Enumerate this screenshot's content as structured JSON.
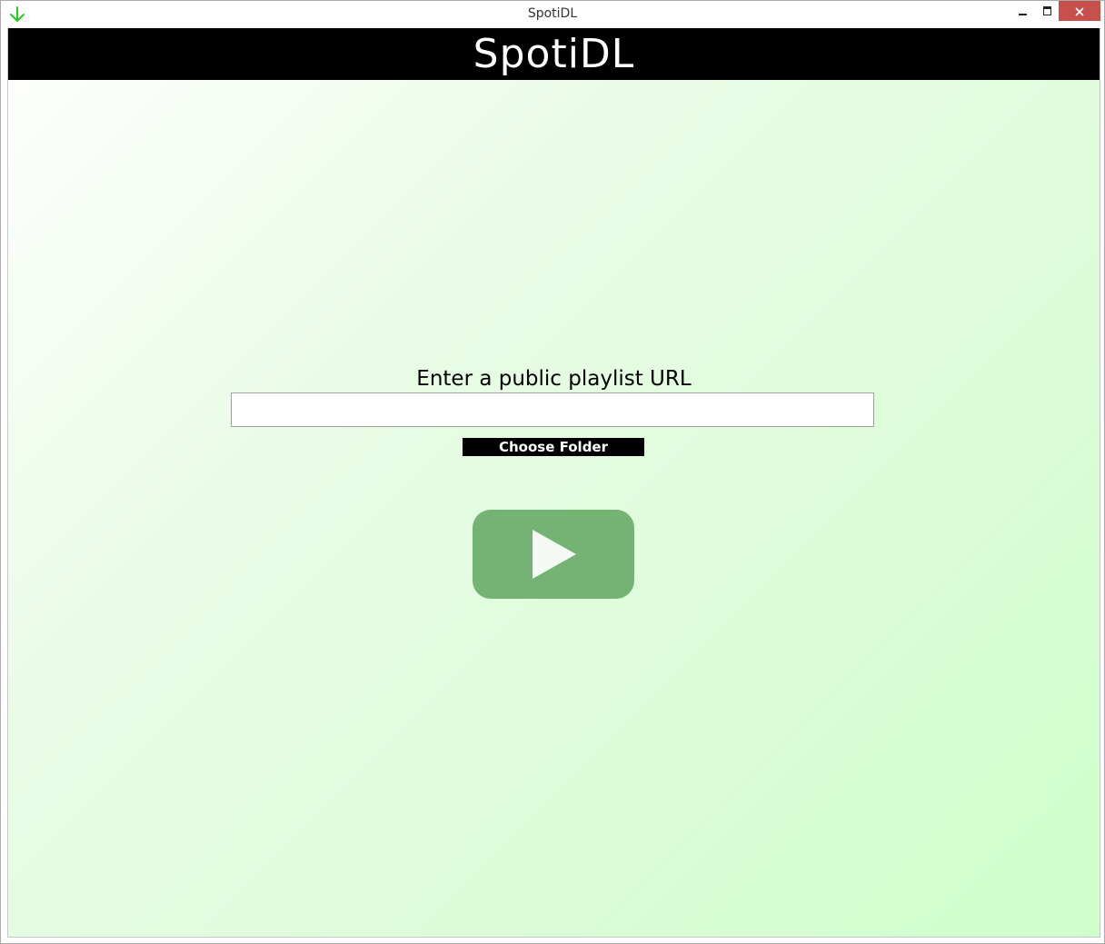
{
  "window": {
    "title": "SpotiDL",
    "icon": "download-arrow-icon",
    "accent": "#22cc22"
  },
  "header": {
    "title": "SpotiDL"
  },
  "form": {
    "url_label": "Enter a public playlist URL",
    "url_value": "",
    "folder_button_label": "Choose Folder",
    "play_button_icon": "play-icon",
    "play_button_color": "#74b374"
  },
  "colors": {
    "header_bg": "#000000",
    "close_button": "#c7504b"
  }
}
